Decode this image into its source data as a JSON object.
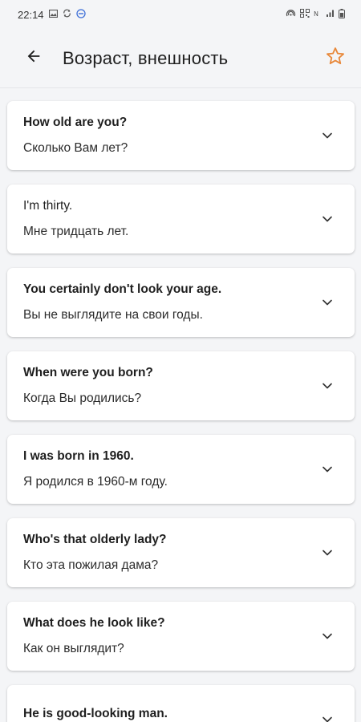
{
  "status_bar": {
    "time": "22:14",
    "left_icons": [
      "image-icon",
      "sync-icon",
      "no-disturb-icon"
    ],
    "right_icons": [
      "hotspot-icon",
      "qr-icon",
      "nfc-icon",
      "signal-icon",
      "battery-icon"
    ]
  },
  "app_bar": {
    "title": "Возраст, внешность",
    "back_icon": "arrow-back-icon",
    "favorite_icon": "star-outline-icon"
  },
  "colors": {
    "accent": "#e8883a",
    "background": "#f4f5f7",
    "card": "#ffffff"
  },
  "phrases": [
    {
      "en": "How old are you?",
      "ru": "Сколько Вам лет?"
    },
    {
      "en": "I'm thirty.",
      "ru": "Мне тридцать лет."
    },
    {
      "en": "You certainly don't look your age.",
      "ru": "Вы не выглядите на свои годы."
    },
    {
      "en": "When were you born?",
      "ru": "Когда Вы родились?"
    },
    {
      "en": "I was born in 1960.",
      "ru": "Я родился в 1960-м году."
    },
    {
      "en": "Who's that olderly lady?",
      "ru": "Кто эта пожилая дама?"
    },
    {
      "en": "What does he look like?",
      "ru": "Как он выглядит?"
    },
    {
      "en": "He is good-looking man.",
      "ru": ""
    }
  ]
}
